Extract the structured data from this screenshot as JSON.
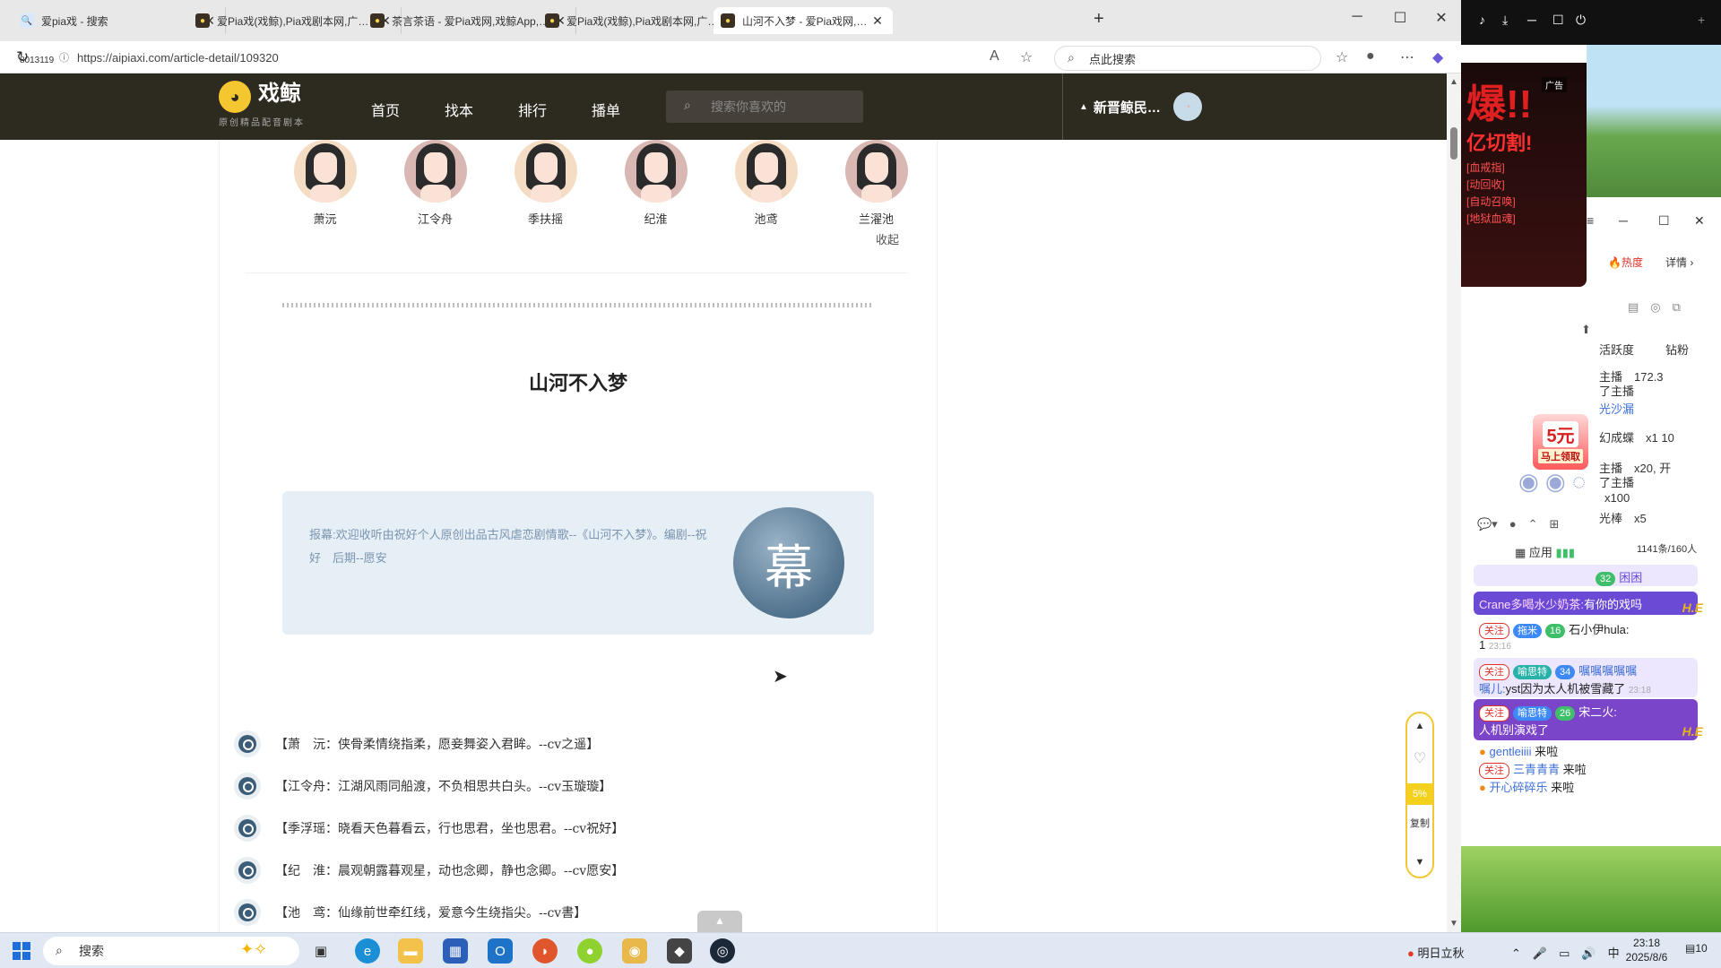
{
  "browser": {
    "tabs": [
      {
        "title": "爱pia戏 - 搜索",
        "favicon": "bing-search-icon"
      },
      {
        "title": "爱Pia戏(戏鲸),Pia戏剧本网,广播剧",
        "favicon": "whale-icon"
      },
      {
        "title": "茶言茶语 - 爱Pia戏网,戏鲸App,Pia",
        "favicon": "whale-icon"
      },
      {
        "title": "爱Pia戏(戏鲸),Pia戏剧本网,广播剧",
        "favicon": "whale-icon"
      },
      {
        "title": "山河不入梦 - 爱Pia戏网,戏鲸App,",
        "favicon": "whale-icon"
      }
    ],
    "url": "https://aipiaxi.com/article-detail/109320",
    "side_badge": "8013119",
    "search_placeholder": "点此搜索"
  },
  "site": {
    "brand": "戏鲸",
    "slogan": "原创精品配音剧本",
    "nav": [
      "首页",
      "找本",
      "排行",
      "播单"
    ],
    "search_placeholder": "搜索你喜欢的",
    "username": "新晋鲸民…"
  },
  "article": {
    "roles": [
      "萧沅",
      "江令舟",
      "季扶摇",
      "纪淮",
      "池鸢",
      "兰濯池"
    ],
    "collapse_label": "收起",
    "title": "山河不入梦",
    "intro": "报幕:欢迎收听由祝好个人原创出品古风虐恋剧情歌--《山河不入梦》。编剧--祝好　后期--愿安",
    "intro_seal_char": "幕",
    "lines": [
      "【萧　沅：侠骨柔情绕指柔，愿妾舞姿入君眸。--cv之遥】",
      "【江令舟：江湖风雨同船渡，不负相思共白头。--cv玉璇璇】",
      "【季浮瑶：晓看天色暮看云，行也思君，坐也思君。--cv祝好】",
      "【纪　淮：晨观朝露暮观星，动也念卿，静也念卿。--cv愿安】",
      "【池　鸢：仙缘前世牵红线，爱意今生绕指尖。--cv書】"
    ]
  },
  "sidetool": {
    "progress_label": "5%",
    "progress_value": 0.05,
    "copy_label": "复制"
  },
  "right_panel": {
    "ad_tag": "广告",
    "ad_big": "爆!!",
    "ad_sub": "亿切割!",
    "ad_lines": [
      "[血戒指]",
      "[动回收]",
      "[自动召唤]",
      "[地狱血魂]"
    ],
    "hot_label": "热度",
    "detail_label": "详情",
    "header_cols": [
      "活跃度",
      "钻粉"
    ],
    "gift_rows": [
      "主播　172.3",
      "了主播",
      "光沙漏",
      "幻成蝶　x1 10",
      "主播　x20, 开",
      "了主播",
      "x100",
      "光棒　x5"
    ],
    "coupon_value": "5元",
    "coupon_label": "马上领取",
    "apps_label": "应用",
    "viewers": "1141条/160人",
    "chat": [
      {
        "user": "困困",
        "badge": "32",
        "text": ""
      },
      {
        "user": "Crane多喝水少奶茶:",
        "text": "有你的戏吗"
      },
      {
        "user": "石小伊hula:",
        "chip": "拖米",
        "badge": "16",
        "text": "1"
      },
      {
        "user": "嘱嘱嘱嘱嘱",
        "chip": "喻思特",
        "badge": "34",
        "text": ""
      },
      {
        "user": "嘱儿:",
        "text": "yst因为太人机被雪藏了"
      },
      {
        "user": "宋二火:",
        "chip": "喻思特",
        "badge": "26",
        "text": "人机别演戏了"
      },
      {
        "user": "gentleiiii",
        "text": "来啦"
      },
      {
        "user": "三青青青",
        "text": "来啦"
      },
      {
        "user": "开心碎碎乐",
        "text": "来啦"
      }
    ],
    "follow_label": "关注",
    "time_1": "23:16",
    "time_2": "23:18",
    "he_label": "H.E"
  },
  "taskbar": {
    "search_label": "搜索",
    "weather": "明日立秋",
    "ime": "中",
    "time": "23:18",
    "date": "2025/8/6",
    "notifications": "10"
  }
}
